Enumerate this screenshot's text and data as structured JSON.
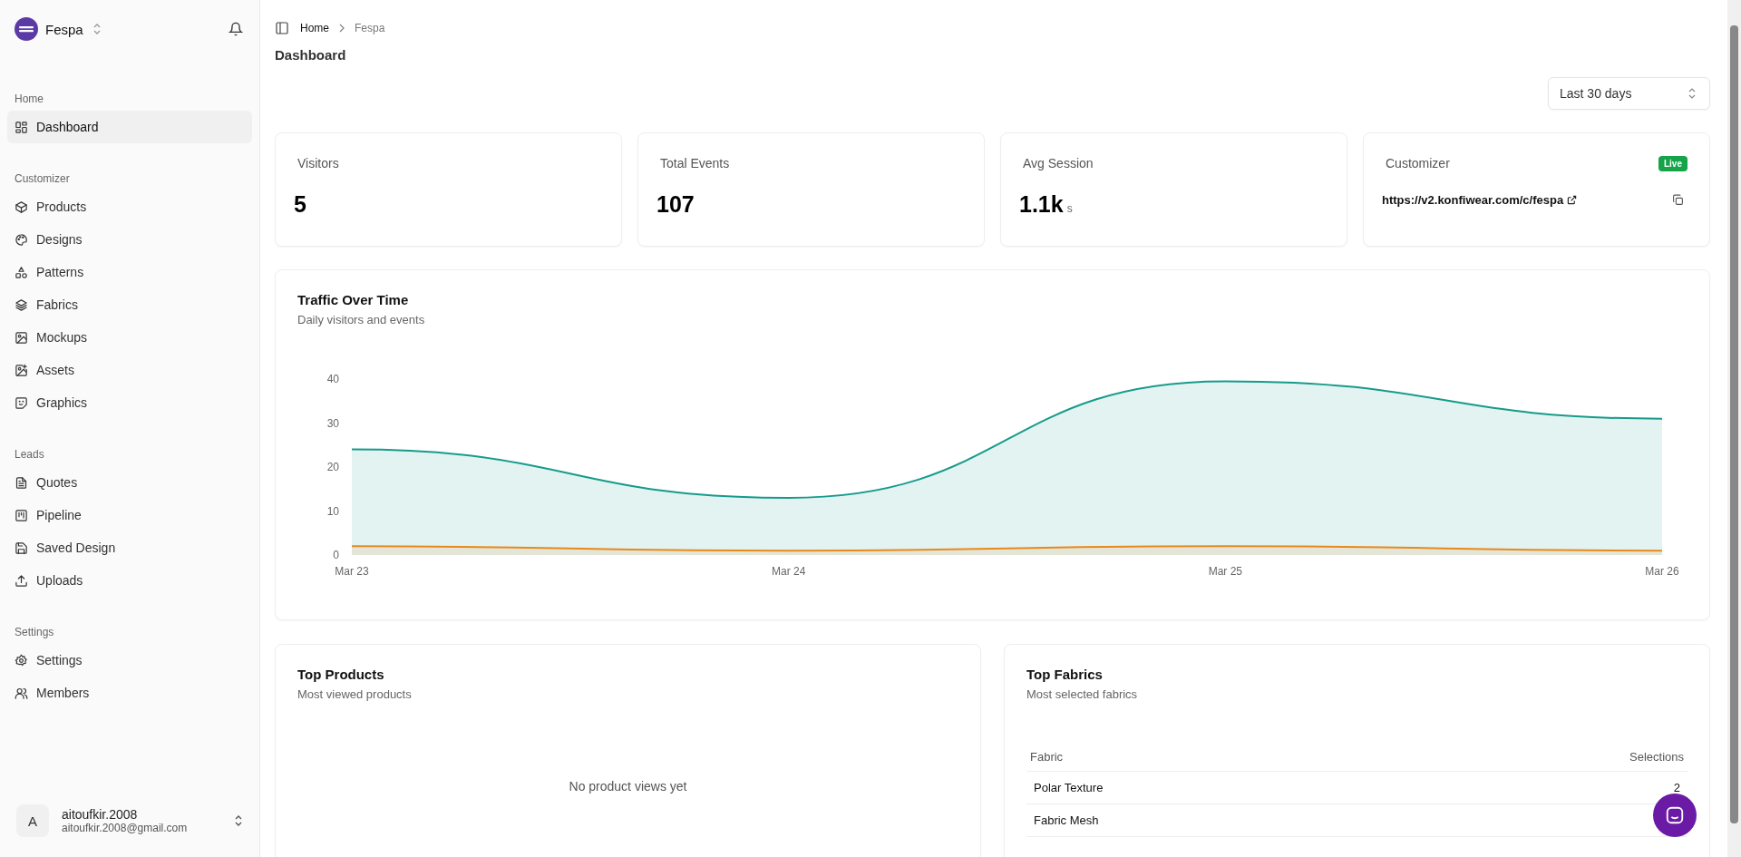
{
  "sidebar": {
    "workspace": "Fespa",
    "sections": [
      {
        "title": "Home",
        "items": [
          {
            "label": "Dashboard",
            "selected": true
          }
        ]
      },
      {
        "title": "Customizer",
        "items": [
          {
            "label": "Products",
            "selected": false
          },
          {
            "label": "Designs",
            "selected": false
          },
          {
            "label": "Patterns",
            "selected": false
          },
          {
            "label": "Fabrics",
            "selected": false
          },
          {
            "label": "Mockups",
            "selected": false
          },
          {
            "label": "Assets",
            "selected": false
          },
          {
            "label": "Graphics",
            "selected": false
          }
        ]
      },
      {
        "title": "Leads",
        "items": [
          {
            "label": "Quotes",
            "selected": false
          },
          {
            "label": "Pipeline",
            "selected": false
          },
          {
            "label": "Saved Design",
            "selected": false
          },
          {
            "label": "Uploads",
            "selected": false
          }
        ]
      },
      {
        "title": "Settings",
        "items": [
          {
            "label": "Settings",
            "selected": false
          },
          {
            "label": "Members",
            "selected": false
          }
        ]
      }
    ],
    "user": {
      "initial": "A",
      "name": "aitoufkir.2008",
      "email": "aitoufkir.2008@gmail.com"
    }
  },
  "breadcrumb": [
    "Home",
    "Fespa"
  ],
  "page_title": "Dashboard",
  "range_select": {
    "value": "Last 30 days"
  },
  "stats": [
    {
      "kind": "metric",
      "label": "Visitors",
      "value": "5"
    },
    {
      "kind": "metric",
      "label": "Total Events",
      "value": "107"
    },
    {
      "kind": "metric",
      "label": "Avg Session",
      "value": "1.1k",
      "unit": "s"
    },
    {
      "kind": "link",
      "label": "Customizer",
      "badge": "Live",
      "url": "https://v2.konfiwear.com/c/fespa"
    }
  ],
  "traffic": {
    "title": "Traffic Over Time",
    "subtitle": "Daily visitors and events",
    "chart_data": {
      "type": "area",
      "categories": [
        "Mar 23",
        "Mar 24",
        "Mar 25",
        "Mar 26"
      ],
      "ylim": [
        0,
        40
      ],
      "yticks": [
        0,
        10,
        20,
        30,
        40
      ],
      "series": [
        {
          "color": "#169b8a",
          "values": [
            24,
            13,
            39.5,
            31
          ]
        },
        {
          "color": "#e8891c",
          "values": [
            2,
            1,
            2,
            1
          ]
        }
      ]
    }
  },
  "top_products": {
    "title": "Top Products",
    "subtitle": "Most viewed products",
    "empty": "No product views yet"
  },
  "top_fabrics": {
    "title": "Top Fabrics",
    "subtitle": "Most selected fabrics",
    "columns": [
      "Fabric",
      "Selections"
    ],
    "rows": [
      {
        "name": "Polar Texture",
        "count": "2"
      },
      {
        "name": "Fabric Mesh"
      }
    ]
  }
}
